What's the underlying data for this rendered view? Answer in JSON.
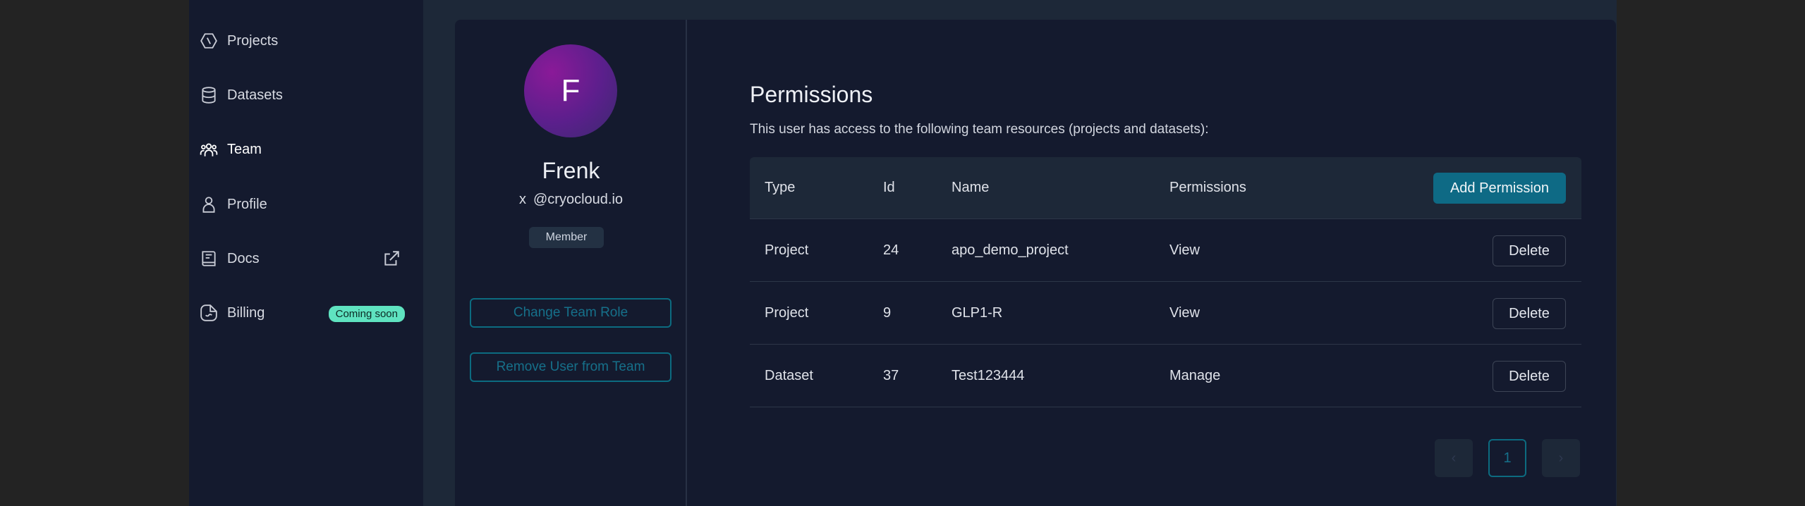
{
  "sidebar": {
    "items": [
      {
        "label": "Projects",
        "icon": "projects-icon"
      },
      {
        "label": "Datasets",
        "icon": "database-icon"
      },
      {
        "label": "Team",
        "icon": "team-icon",
        "active": true
      },
      {
        "label": "Profile",
        "icon": "user-icon"
      },
      {
        "label": "Docs",
        "icon": "book-icon",
        "external_icon": "external-link-icon"
      },
      {
        "label": "Billing",
        "icon": "billing-icon",
        "badge": "Coming soon"
      }
    ]
  },
  "profile": {
    "avatar_letter": "F",
    "name": "Frenk",
    "email_prefix": "x",
    "email": "@cryocloud.io",
    "role": "Member",
    "change_role_label": "Change Team Role",
    "remove_label": "Remove User from Team"
  },
  "permissions": {
    "title": "Permissions",
    "subtitle": "This user has access to the following team resources (projects and datasets):",
    "columns": {
      "type": "Type",
      "id": "Id",
      "name": "Name",
      "permissions": "Permissions"
    },
    "add_label": "Add Permission",
    "delete_label": "Delete",
    "rows": [
      {
        "type": "Project",
        "id": "24",
        "name": "apo_demo_project",
        "permission": "View"
      },
      {
        "type": "Project",
        "id": "9",
        "name": "GLP1-R",
        "permission": "View"
      },
      {
        "type": "Dataset",
        "id": "37",
        "name": "Test123444",
        "permission": "Manage"
      }
    ]
  },
  "pagination": {
    "prev": "‹",
    "current": "1",
    "next": "›"
  },
  "colors": {
    "accent": "#0e6a85",
    "badge_soon": "#5fe3c0",
    "background": "#141a2e"
  }
}
